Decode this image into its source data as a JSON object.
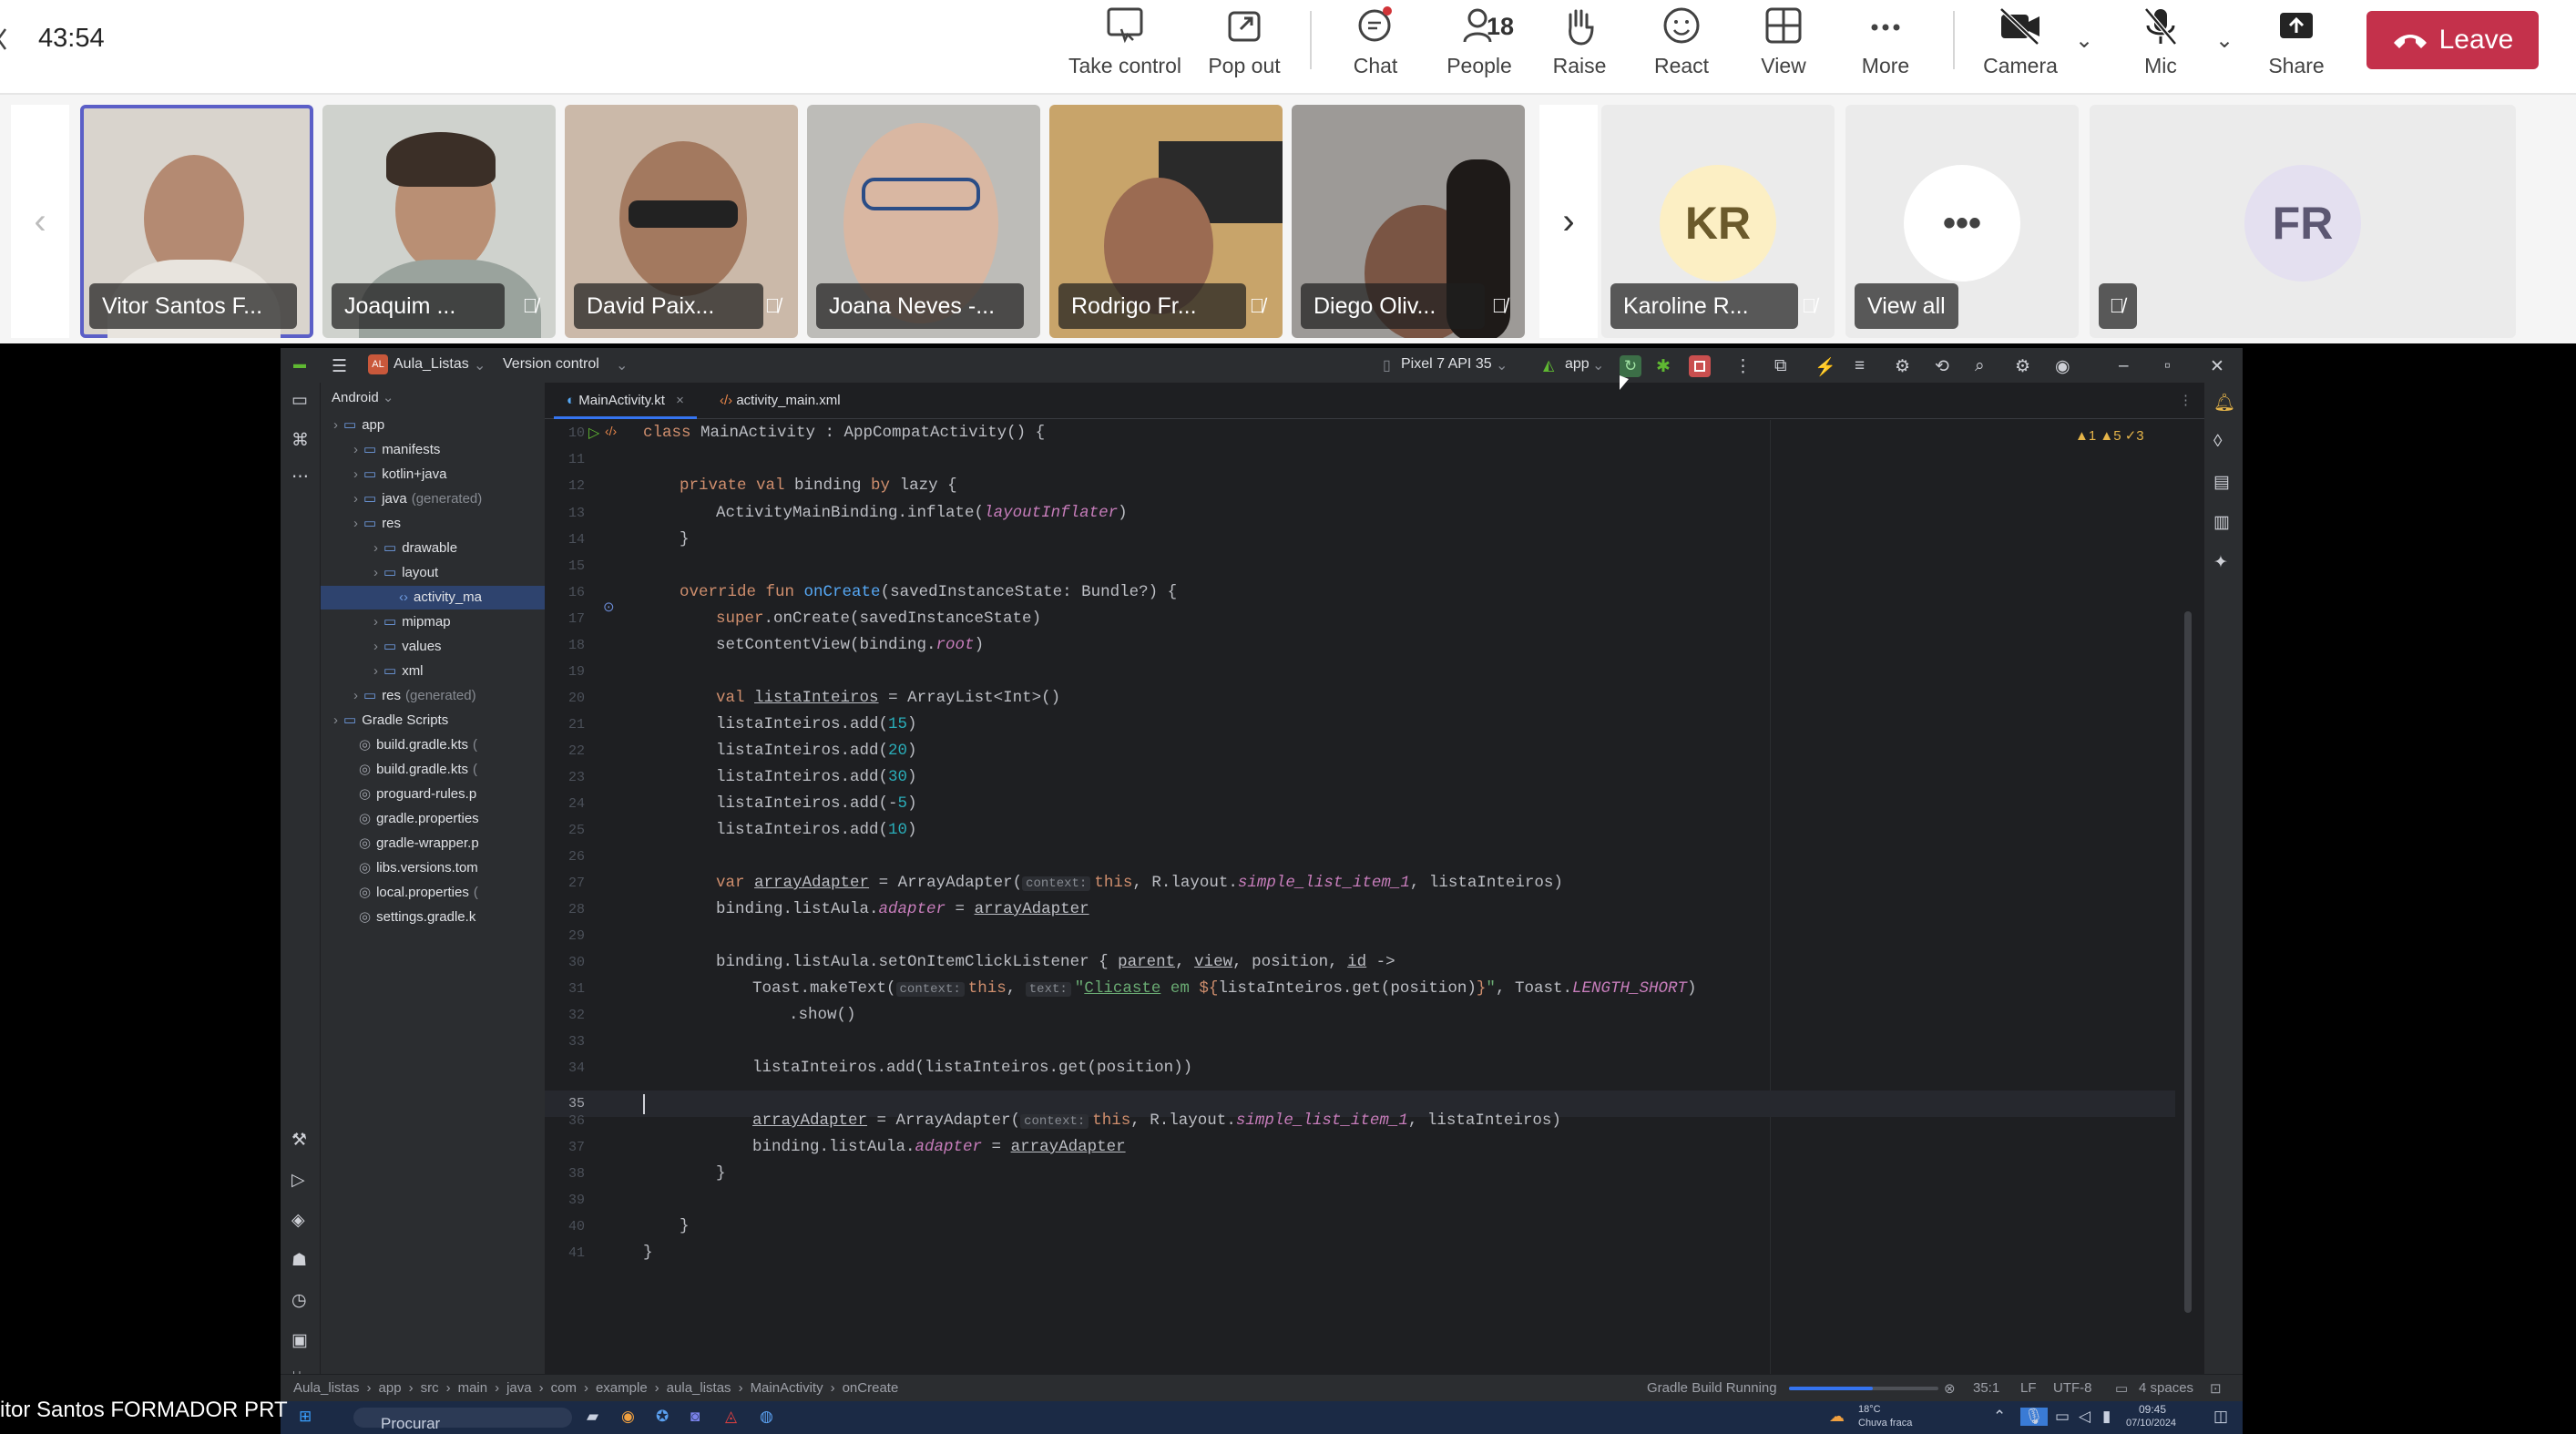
{
  "meeting": {
    "timer": "43:54",
    "toolbar": {
      "take_control": "Take control",
      "pop_out": "Pop out",
      "chat": "Chat",
      "people": "People",
      "people_count": "18",
      "raise": "Raise",
      "react": "React",
      "view": "View",
      "more": "More",
      "camera": "Camera",
      "mic": "Mic",
      "share": "Share",
      "leave": "Leave"
    },
    "participants": [
      {
        "name": "Vitor Santos F...",
        "muted": false
      },
      {
        "name": "Joaquim ...",
        "muted": true
      },
      {
        "name": "David Paix...",
        "muted": true
      },
      {
        "name": "Joana Neves -...",
        "muted": false
      },
      {
        "name": "Rodrigo Fr...",
        "muted": true
      },
      {
        "name": "Diego Oliv...",
        "muted": true
      },
      {
        "name": "Karoline R...",
        "initials": "KR",
        "muted": true
      },
      {
        "name": "View all",
        "initials": "•••"
      },
      {
        "name": "",
        "initials": "FR",
        "muted": true
      }
    ],
    "presenter_caption": "itor Santos FORMADOR PRT"
  },
  "ide": {
    "project_name": "Aula_Listas",
    "project_badge": "AL",
    "version_control": "Version control",
    "device": "Pixel 7 API 35",
    "run_config": "app",
    "project_view": "Android",
    "tree": [
      {
        "label": "app",
        "level": 0,
        "gray": false
      },
      {
        "label": "manifests",
        "level": 1,
        "gray": false
      },
      {
        "label": "kotlin+java",
        "level": 1,
        "gray": false
      },
      {
        "label": "java",
        "level": 1,
        "gray": false,
        "suffix": "(generated)"
      },
      {
        "label": "res",
        "level": 1,
        "gray": false
      },
      {
        "label": "drawable",
        "level": 2,
        "gray": false
      },
      {
        "label": "layout",
        "level": 2,
        "gray": false
      },
      {
        "label": "activity_ma",
        "level": 3,
        "gray": false
      },
      {
        "label": "mipmap",
        "level": 2,
        "gray": false
      },
      {
        "label": "values",
        "level": 2,
        "gray": false
      },
      {
        "label": "xml",
        "level": 2,
        "gray": false
      },
      {
        "label": "res",
        "level": 1,
        "gray": false,
        "suffix": "(generated)"
      },
      {
        "label": "Gradle Scripts",
        "level": 0,
        "gray": false
      },
      {
        "label": "build.gradle.kts",
        "level": 1,
        "gray": false,
        "suffix": "("
      },
      {
        "label": "build.gradle.kts",
        "level": 1,
        "gray": false,
        "suffix": "("
      },
      {
        "label": "proguard-rules.p",
        "level": 1,
        "gray": false
      },
      {
        "label": "gradle.properties",
        "level": 1,
        "gray": false
      },
      {
        "label": "gradle-wrapper.p",
        "level": 1,
        "gray": false
      },
      {
        "label": "libs.versions.tom",
        "level": 1,
        "gray": false
      },
      {
        "label": "local.properties",
        "level": 1,
        "gray": false,
        "suffix": "("
      },
      {
        "label": "settings.gradle.k",
        "level": 1,
        "gray": false
      }
    ],
    "tabs": [
      {
        "label": "MainActivity.kt",
        "active": true
      },
      {
        "label": "activity_main.xml",
        "active": false
      }
    ],
    "inspections": "▲1  ▲5  ✓3",
    "line_numbers": [
      "10",
      "11",
      "12",
      "13",
      "14",
      "15",
      "16",
      "17",
      "18",
      "19",
      "20",
      "21",
      "22",
      "23",
      "24",
      "25",
      "26",
      "27",
      "28",
      "29",
      "30",
      "31",
      "32",
      "33",
      "34",
      "35",
      "36",
      "37",
      "38",
      "39",
      "40",
      "41"
    ],
    "current_line": "35",
    "status": {
      "breadcrumb": [
        "Aula_listas",
        "app",
        "src",
        "main",
        "java",
        "com",
        "example",
        "aula_listas",
        "MainActivity",
        "onCreate"
      ],
      "build": "Gradle Build Running",
      "build_progress": 0.56,
      "position": "35:1",
      "line_sep": "LF",
      "encoding": "UTF-8",
      "indent": "4 spaces"
    },
    "taskbar": {
      "search": "Procurar",
      "temperature": "18°C",
      "weather": "Chuva fraca",
      "time": "09:45",
      "date": "07/10/2024"
    }
  }
}
